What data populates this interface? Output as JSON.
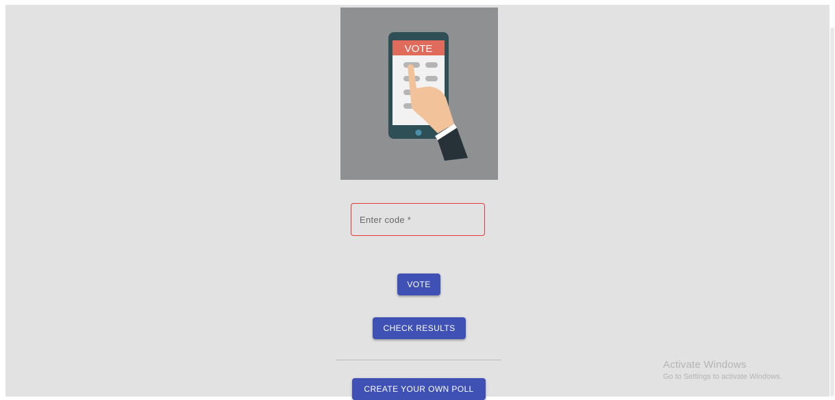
{
  "hero": {
    "illustration_label": "VOTE",
    "colors": {
      "background": "#8e9092",
      "phone_body": "#2f4f57",
      "screen": "#f2f2f2",
      "banner": "#e06b5a",
      "option_pill": "#b5b5b5",
      "hand_skin": "#f2c39b",
      "sleeve": "#263238"
    }
  },
  "form": {
    "code_placeholder": "Enter code *",
    "code_value": "",
    "border_color": "#e53935"
  },
  "buttons": {
    "vote_label": "VOTE",
    "check_results_label": "CHECK RESULTS",
    "create_poll_label": "CREATE YOUR OWN POLL",
    "color": "#3f51b5"
  },
  "watermark": {
    "title": "Activate Windows",
    "subtitle": "Go to Settings to activate Windows."
  }
}
